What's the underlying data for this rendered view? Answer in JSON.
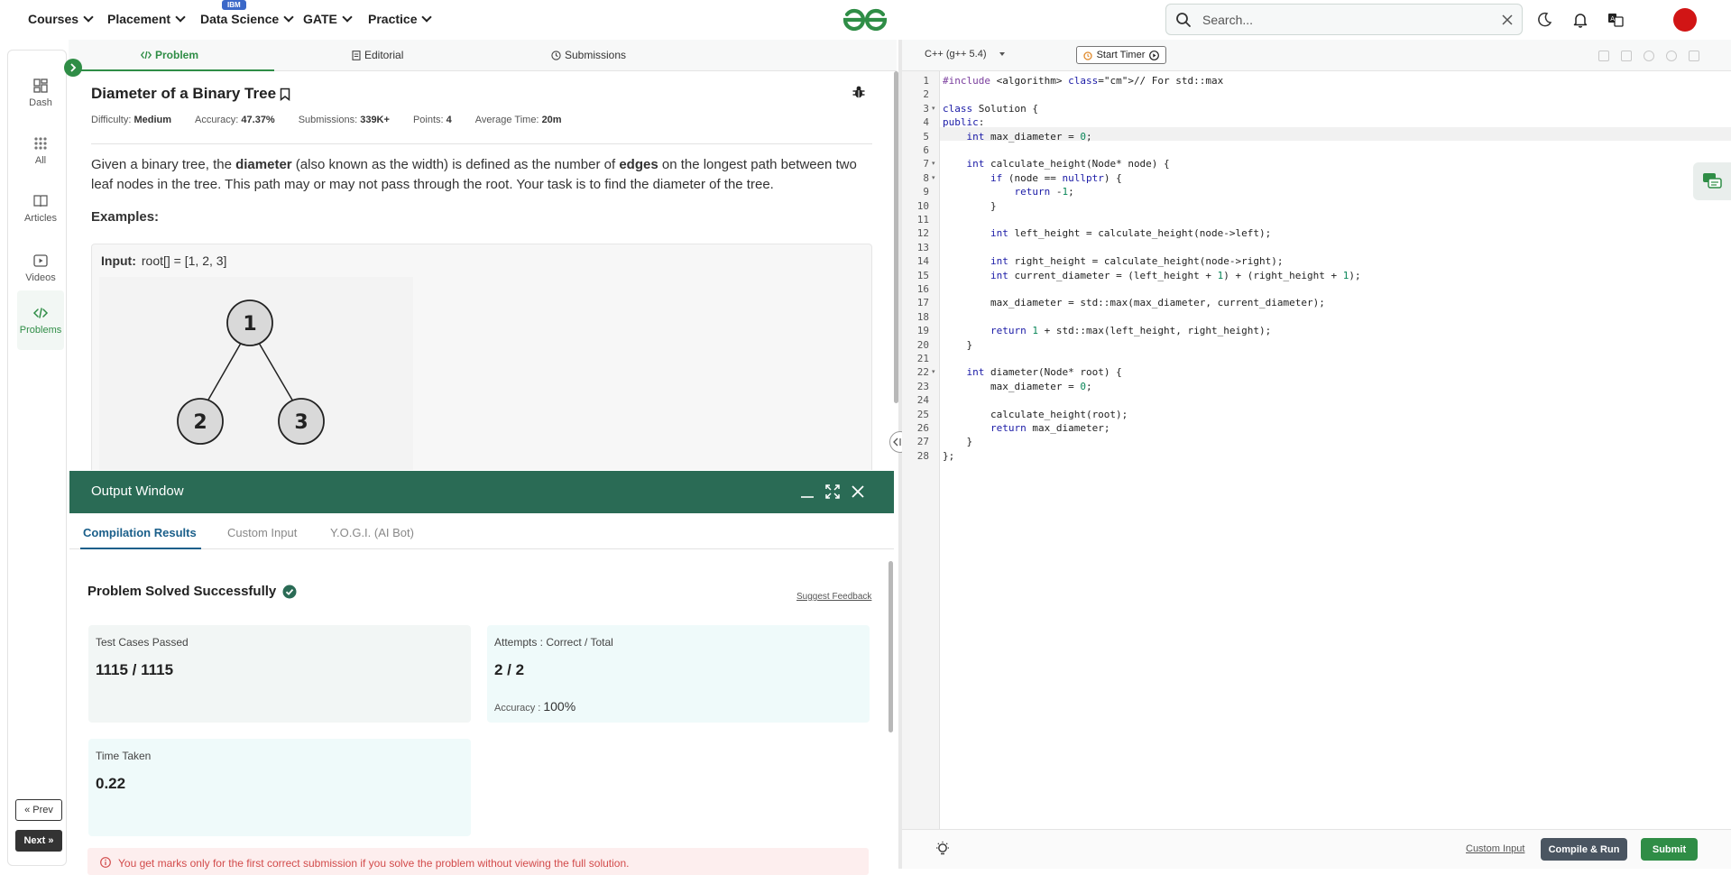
{
  "nav": {
    "items": [
      {
        "label": "Courses"
      },
      {
        "label": "Placement"
      },
      {
        "label": "Data Science"
      },
      {
        "label": "GATE"
      },
      {
        "label": "Practice"
      }
    ],
    "badge": "IBM",
    "search_placeholder": "Search..."
  },
  "rail": {
    "items": [
      "Dash",
      "All",
      "Articles",
      "Videos",
      "Problems"
    ],
    "prev_label": "« Prev",
    "next_label": "Next »"
  },
  "problem_tabs": [
    "Problem",
    "Editorial",
    "Submissions"
  ],
  "problem": {
    "title": "Diameter of a Binary Tree",
    "meta": {
      "difficulty_label": "Difficulty:",
      "difficulty": "Medium",
      "accuracy_label": "Accuracy:",
      "accuracy": "47.37%",
      "submissions_label": "Submissions:",
      "submissions": "339K+",
      "points_label": "Points:",
      "points": "4",
      "avg_time_label": "Average Time:",
      "avg_time": "20m"
    },
    "desc_1": "Given a binary tree, the ",
    "desc_b1": "diameter",
    "desc_2": " (also known as the width) is defined as the number of ",
    "desc_b2": "edges",
    "desc_3": " on the longest path between two leaf nodes in the tree. This path may or may not pass through the root. Your task is to find the diameter of the tree.",
    "examples_label": "Examples:",
    "example_input_label": "Input:",
    "example_input_value": "root[] = [1, 2, 3]",
    "tree_nodes": [
      "1",
      "2",
      "3"
    ]
  },
  "output": {
    "title": "Output Window",
    "tabs": [
      "Compilation Results",
      "Custom Input",
      "Y.O.G.I. (AI Bot)"
    ],
    "status": "Problem Solved Successfully",
    "feedback": "Suggest Feedback",
    "test_cases_label": "Test Cases Passed",
    "test_cases_value": "1115 / 1115",
    "attempts_label": "Attempts : Correct / Total",
    "attempts_value": "2 / 2",
    "accuracy_label": "Accuracy :",
    "accuracy_value": "100%",
    "time_label": "Time Taken",
    "time_value": "0.22",
    "warning": "You get marks only for the first correct submission if you solve the problem without viewing the full solution."
  },
  "editor": {
    "language": "C++ (g++ 5.4)",
    "timer_label": "Start Timer",
    "custom_input": "Custom Input",
    "compile_label": "Compile & Run",
    "submit_label": "Submit",
    "code_lines": [
      "#include <algorithm> // For std::max",
      "",
      "class Solution {",
      "public:",
      "    int max_diameter = 0;",
      "",
      "    int calculate_height(Node* node) {",
      "        if (node == nullptr) {",
      "            return -1;",
      "        }",
      "",
      "        int left_height = calculate_height(node->left);",
      "",
      "        int right_height = calculate_height(node->right);",
      "        int current_diameter = (left_height + 1) + (right_height + 1);",
      "",
      "        max_diameter = std::max(max_diameter, current_diameter);",
      "",
      "        return 1 + std::max(left_height, right_height);",
      "    }",
      "",
      "    int diameter(Node* root) {",
      "        max_diameter = 0;",
      "",
      "        calculate_height(root);",
      "        return max_diameter;",
      "    }",
      "};"
    ]
  },
  "colors": {
    "brand_green": "#2f8d46",
    "output_header": "#2a6b55",
    "tab_blue": "#1a5f8a",
    "avatar_red": "#d11515"
  }
}
